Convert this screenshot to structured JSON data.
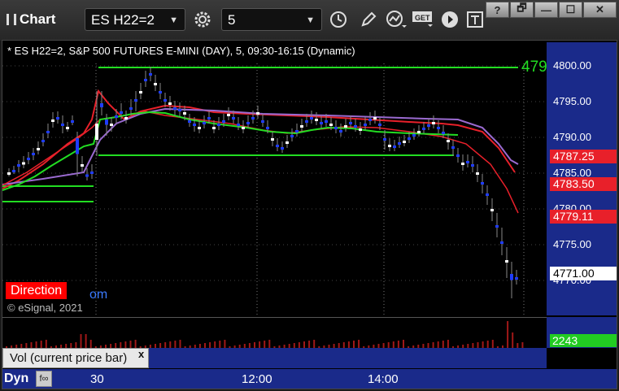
{
  "app": {
    "title": "Chart"
  },
  "toolbar": {
    "symbol": "ES H22=2",
    "interval": "5",
    "get_label": "GET"
  },
  "window": {
    "help": "?",
    "restore": "🗗",
    "minimize": "—",
    "maximize": "☐",
    "close": "✕"
  },
  "chart": {
    "symbol_line": "* ES H22=2, S&P 500 FUTURES E-MINI (DAY), 5, 09:30-16:15 (Dynamic)",
    "price_labels": [
      "4800.00",
      "4795.00",
      "4790.00",
      "4785.00",
      "4780.00",
      "4775.00",
      "4770.00"
    ],
    "price_boxes": [
      {
        "value": "4787.25",
        "bg": "#e8202a",
        "fg": "#ffffff"
      },
      {
        "value": "4783.50",
        "bg": "#e8202a",
        "fg": "#ffffff"
      },
      {
        "value": "4779.11",
        "bg": "#e8202a",
        "fg": "#ffffff"
      },
      {
        "value": "4771.00",
        "bg": "#ffffff",
        "fg": "#000000"
      }
    ],
    "level_label": "479",
    "direction_label": "Direction",
    "link_fragment": "om",
    "copyright": "© eSignal, 2021"
  },
  "volume": {
    "tab_label": "Vol (current price bar)",
    "close": "x",
    "value": "2243"
  },
  "time_axis": {
    "labels": [
      "30",
      "12:00",
      "14:00"
    ],
    "mode": "Dyn"
  },
  "colors": {
    "up": "#ffffff",
    "down": "#1f3cff",
    "green_line": "#22dd22",
    "red_line": "#e8202a",
    "purple_line": "#9a6ad0",
    "axis_bg": "#1a2a8a"
  }
}
